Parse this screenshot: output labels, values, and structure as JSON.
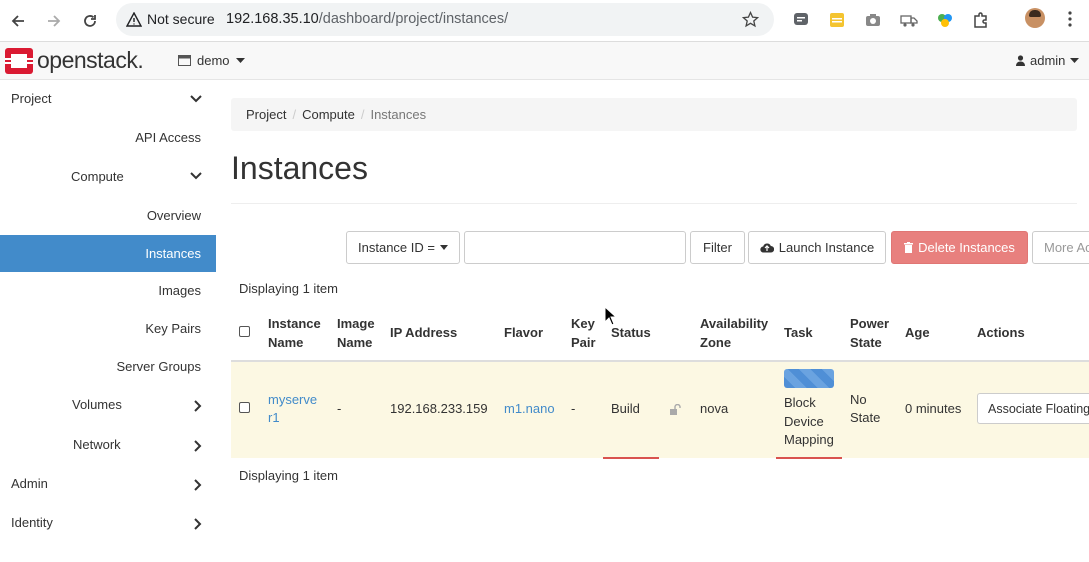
{
  "browser": {
    "security_label": "Not secure",
    "url_host": "192.168.35.10",
    "url_path": "/dashboard/project/instances/"
  },
  "header": {
    "logo_text": "openstack.",
    "project": "demo",
    "user": "admin",
    "brand_color": "#da1a32"
  },
  "sidebar": {
    "items": [
      {
        "label": "Project"
      },
      {
        "label": "API Access"
      },
      {
        "label": "Compute"
      },
      {
        "label": "Overview"
      },
      {
        "label": "Instances"
      },
      {
        "label": "Images"
      },
      {
        "label": "Key Pairs"
      },
      {
        "label": "Server Groups"
      },
      {
        "label": "Volumes"
      },
      {
        "label": "Network"
      },
      {
        "label": "Admin"
      },
      {
        "label": "Identity"
      }
    ],
    "active_color": "#428bca"
  },
  "breadcrumb": {
    "items": [
      "Project",
      "Compute",
      "Instances"
    ]
  },
  "page": {
    "title": "Instances"
  },
  "toolbar": {
    "filter_select": "Instance ID =",
    "filter_input_value": "",
    "filter_button": "Filter",
    "launch_button": "Launch Instance",
    "delete_button": "Delete Instances",
    "more_button": "More Ac"
  },
  "table": {
    "summary_top": "Displaying 1 item",
    "summary_bottom": "Displaying 1 item",
    "headers": {
      "instance_name": [
        "Instance",
        "Name"
      ],
      "image_name": [
        "Image",
        "Name"
      ],
      "ip": "IP Address",
      "flavor": "Flavor",
      "key_pair": [
        "Key",
        "Pair"
      ],
      "status": "Status",
      "az": [
        "Availability",
        "Zone"
      ],
      "task": "Task",
      "power": [
        "Power",
        "State"
      ],
      "age": "Age",
      "actions": "Actions"
    },
    "rows": [
      {
        "name": [
          "myserve",
          "r1"
        ],
        "image": "-",
        "ip": "192.168.233.159",
        "flavor": "m1.nano",
        "key_pair": "-",
        "status": "Build",
        "az": "nova",
        "task": [
          "Block",
          "Device",
          "Mapping"
        ],
        "power": [
          "No",
          "State"
        ],
        "age": "0 minutes",
        "action": "Associate Floating"
      }
    ]
  }
}
